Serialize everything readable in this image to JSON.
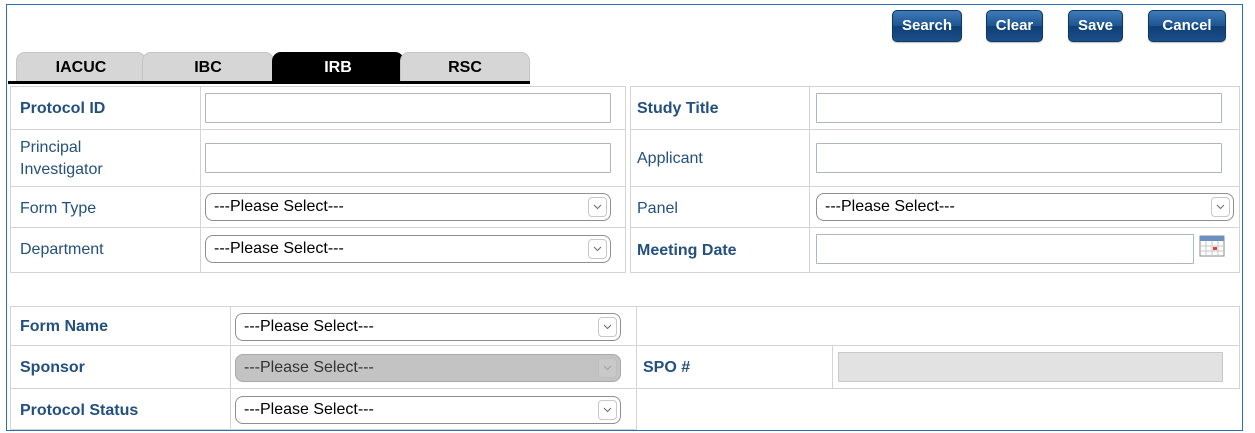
{
  "toolbar": {
    "search_label": "Search",
    "clear_label": "Clear",
    "save_label": "Save",
    "cancel_label": "Cancel"
  },
  "tabs": [
    {
      "label": "IACUC",
      "active": false
    },
    {
      "label": "IBC",
      "active": false
    },
    {
      "label": "IRB",
      "active": true
    },
    {
      "label": "RSC",
      "active": false
    }
  ],
  "criteria": {
    "protocol_id": {
      "label": "Protocol ID",
      "value": ""
    },
    "study_title": {
      "label": "Study Title",
      "value": ""
    },
    "pi_line1": "Principal",
    "pi_line2": "Investigator",
    "pi_value": "",
    "applicant": {
      "label": "Applicant",
      "value": ""
    },
    "form_type": {
      "label": "Form Type",
      "selected": "---Please Select---"
    },
    "panel": {
      "label": "Panel",
      "selected": "---Please Select---"
    },
    "department": {
      "label": "Department",
      "selected": "---Please Select---"
    },
    "meeting_date": {
      "label": "Meeting Date",
      "value": ""
    }
  },
  "extra": {
    "form_name": {
      "label": "Form Name",
      "selected": "---Please Select---"
    },
    "sponsor": {
      "label": "Sponsor",
      "selected": "---Please Select---"
    },
    "spo": {
      "label": "SPO #",
      "value": ""
    },
    "protocol_status": {
      "label": "Protocol Status",
      "selected": "---Please Select---"
    }
  },
  "colors": {
    "label_blue": "#23507e",
    "button_blue": "#1d5492",
    "active_tab": "#000000",
    "inactive_tab": "#d6d6d6"
  }
}
